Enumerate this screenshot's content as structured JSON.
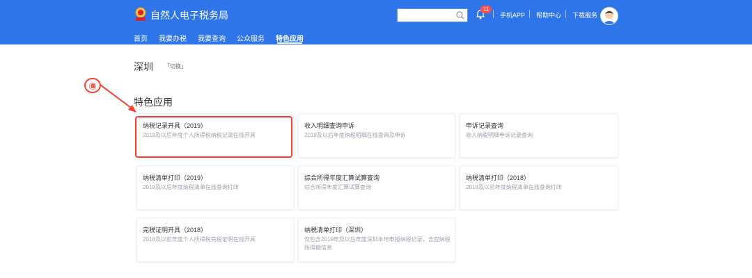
{
  "header": {
    "title": "自然人电子税务局",
    "search_placeholder": "",
    "notification_count": "11",
    "links": [
      "手机APP",
      "帮助中心",
      "下载服务"
    ],
    "nav": [
      "首页",
      "我要办税",
      "我要查询",
      "公众服务",
      "特色应用"
    ],
    "active_nav": "特色应用"
  },
  "location": {
    "city": "深圳",
    "switch_label": "「切换」"
  },
  "section": {
    "title": "特色应用"
  },
  "annotation": {
    "label": "⑧"
  },
  "cards": [
    {
      "title": "纳税记录开具（2019）",
      "desc": "2019及以后年度个人所得税纳税记录在线开具"
    },
    {
      "title": "收入明细查询申诉",
      "desc": "2019及以后年度纳税明细在线查询及申诉"
    },
    {
      "title": "申诉记录查询",
      "desc": "收入纳税明细申诉记录查询"
    },
    {
      "title": "纳税清单打印（2019）",
      "desc": "2019及以后年度纳税清单在线查询打印"
    },
    {
      "title": "综合所得年度汇算试算查询",
      "desc": "综合所得年度汇算试算查询"
    },
    {
      "title": "纳税清单打印（2018）",
      "desc": "2018及以前年度纳税清单在线查询打印"
    },
    {
      "title": "完税证明开具（2018）",
      "desc": "2018及以前年度个人所得税完税证明在线开具"
    },
    {
      "title": "纳税清单打印（深圳）",
      "desc": "仅包含2019年及以后年度深圳本地申报纳税记录，含应纳税所得额信息"
    }
  ],
  "colors": {
    "header_bg": "#2f75ea",
    "highlight": "#ff3b30"
  }
}
